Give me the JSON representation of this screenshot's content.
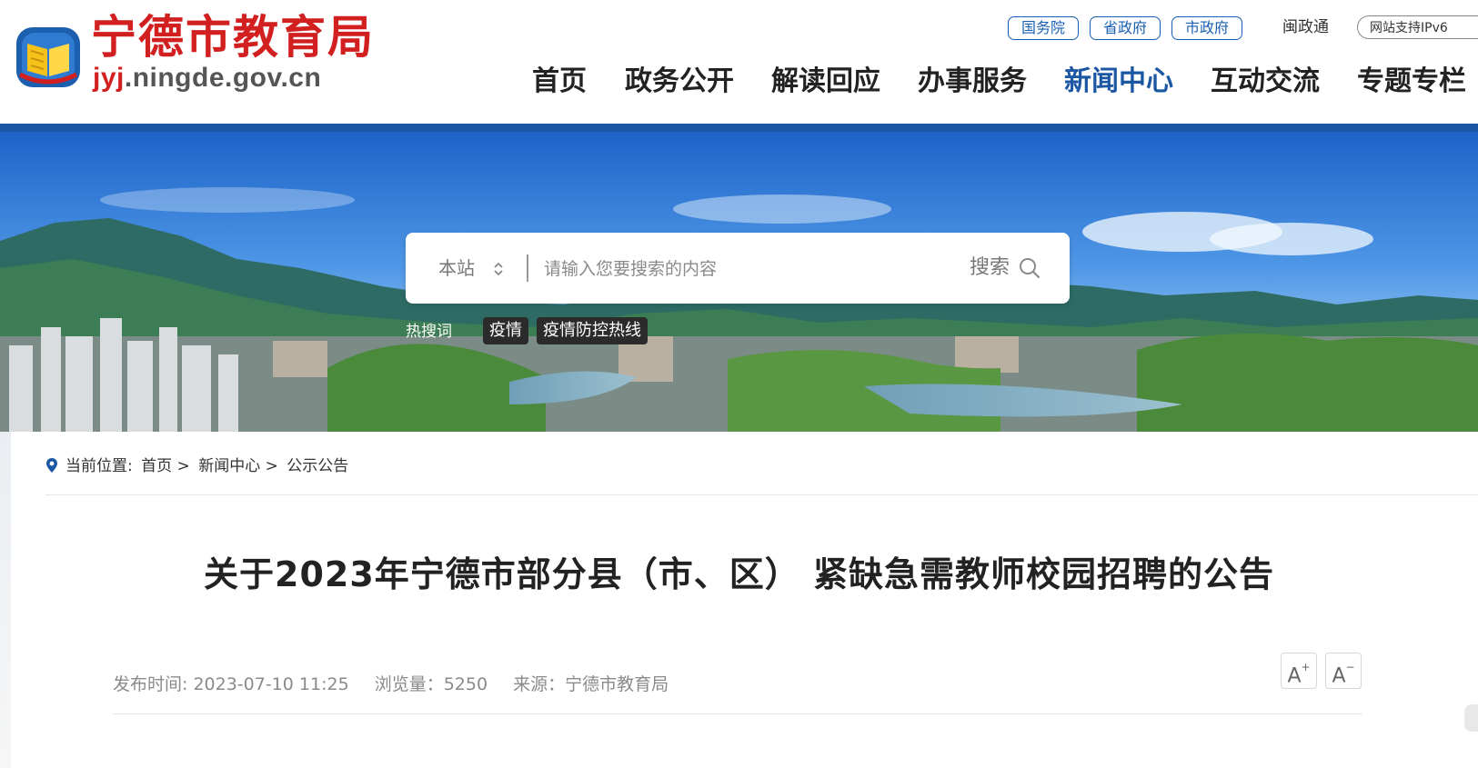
{
  "site": {
    "title": "宁德市教育局",
    "domain_highlight": "jyj",
    "domain_rest": ".ningde.gov.cn"
  },
  "gov_links": [
    "国务院",
    "省政府",
    "市政府"
  ],
  "top_link": "闽政通",
  "support_pill": "网站支持IPv6",
  "nav": {
    "items": [
      "首页",
      "政务公开",
      "解读回应",
      "办事服务",
      "新闻中心",
      "互动交流",
      "专题专栏"
    ],
    "active_index": 4
  },
  "search": {
    "scope": "本站",
    "placeholder": "请输入您要搜索的内容",
    "button_label": "搜索"
  },
  "hot": {
    "label": "热搜词",
    "tags": [
      "疫情",
      "疫情防控热线"
    ]
  },
  "breadcrumb": {
    "prefix": "当前位置:",
    "items": [
      "首页",
      "新闻中心",
      "公示公告"
    ],
    "separator": ">"
  },
  "article": {
    "title": "关于2023年宁德市部分县（市、区） 紧缺急需教师校园招聘的公告",
    "published": "发布时间: 2023-07-10 11:25",
    "views": "浏览量：5250",
    "source": "来源：宁德市教育局"
  },
  "font_size": {
    "increase": "A",
    "increase_mark": "+",
    "decrease": "A",
    "decrease_mark": "−"
  },
  "colors": {
    "brand_red": "#d21f1f",
    "brand_blue": "#1c57a4",
    "gov_link_blue": "#1a5fb4"
  }
}
